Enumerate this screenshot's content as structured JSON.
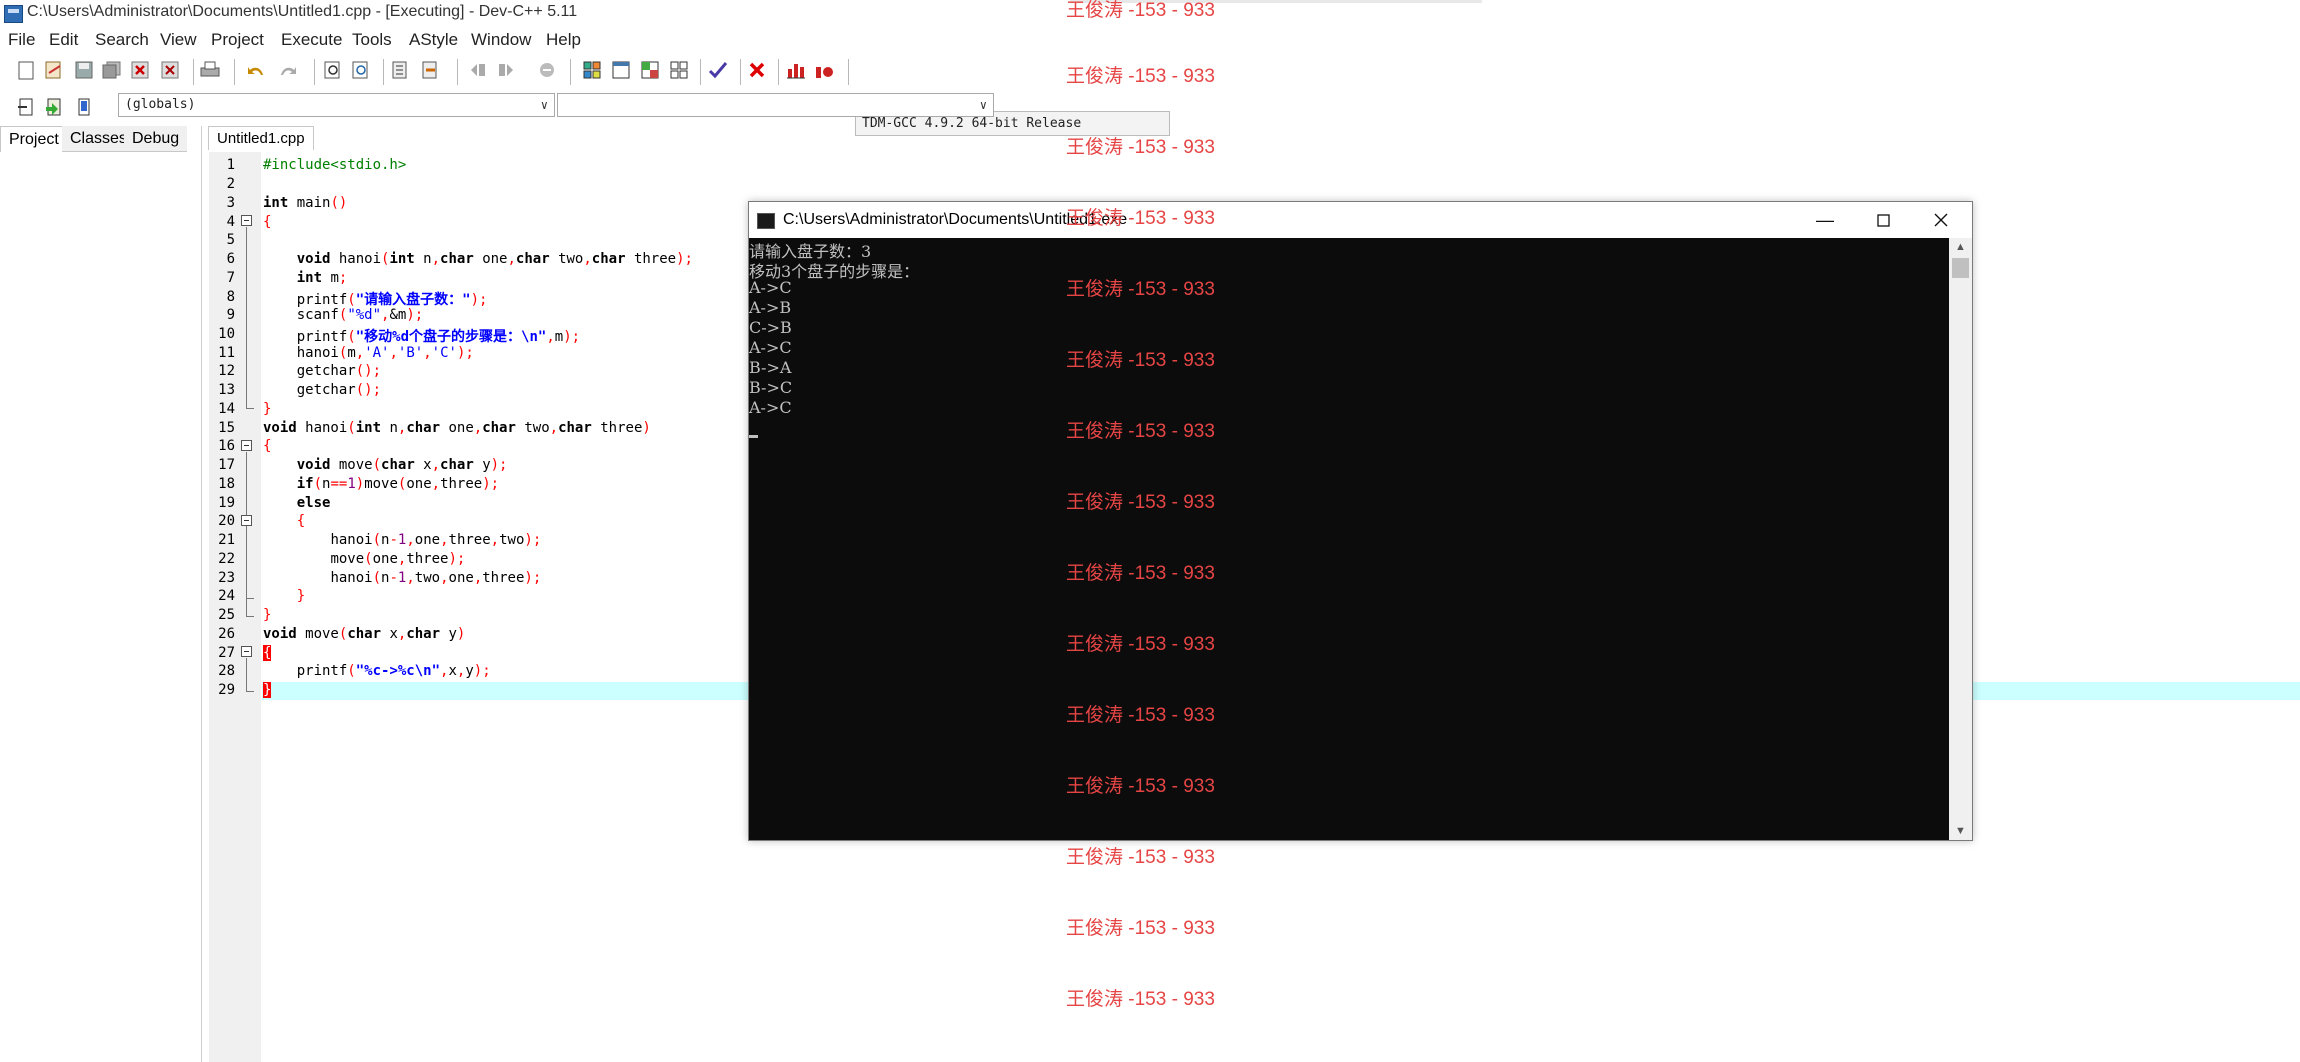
{
  "window": {
    "title": "C:\\Users\\Administrator\\Documents\\Untitled1.cpp - [Executing] - Dev-C++ 5.11"
  },
  "menu": [
    "File",
    "Edit",
    "Search",
    "View",
    "Project",
    "Execute",
    "Tools",
    "AStyle",
    "Window",
    "Help"
  ],
  "toolbar": {
    "compiler": "TDM-GCC 4.9.2 64-bit Release",
    "globals_combo": "(globals)",
    "functions_combo": ""
  },
  "leftpanel": {
    "tabs": [
      "Project",
      "Classes",
      "Debug"
    ],
    "active": "Project"
  },
  "editor": {
    "tab": "Untitled1.cpp",
    "line_numbers": [
      "1",
      "2",
      "3",
      "4",
      "5",
      "6",
      "7",
      "8",
      "9",
      "10",
      "11",
      "12",
      "13",
      "14",
      "15",
      "16",
      "17",
      "18",
      "19",
      "20",
      "21",
      "22",
      "23",
      "24",
      "25",
      "26",
      "27",
      "28",
      "29"
    ],
    "code": {
      "l1": "#include<stdio.h>",
      "l3a": "int",
      "l3b": " main",
      "l4": "{",
      "l6a": "void",
      "l6b": " hanoi",
      "l6c": "int",
      "l6d": " n",
      "l6e": "char",
      "l6f": " one",
      "l6g": "char",
      "l6h": " two",
      "l6i": "char",
      "l6j": " three",
      "l7a": "int",
      "l7b": " m",
      "l8a": "printf",
      "l8b": "\"请输入盘子数：\"",
      "l9a": "scanf",
      "l9b": "\"%d\"",
      "l9c": "&m",
      "l10a": "printf",
      "l10b": "\"移动%d个盘子的步骤是：\\n\"",
      "l10c": "m",
      "l11a": "hanoi",
      "l11b": "m",
      "l11c": "'A'",
      "l11d": "'B'",
      "l11e": "'C'",
      "l12": "getchar",
      "l13": "getchar",
      "l14": "}",
      "l15a": "void",
      "l15b": " hanoi",
      "l15c": "int",
      "l15d": " n",
      "l15e": "char",
      "l15f": " one",
      "l15g": "char",
      "l15h": " two",
      "l15i": "char",
      "l15j": " three",
      "l16": "{",
      "l17a": "void",
      "l17b": " move",
      "l17c": "char",
      "l17d": " x",
      "l17e": "char",
      "l17f": " y",
      "l18a": "if",
      "l18b": "n",
      "l18c": "1",
      "l18d": "move",
      "l18e": "one",
      "l18f": "three",
      "l19": "else",
      "l20": "{",
      "l21a": "hanoi",
      "l21b": "n",
      "l21c": "1",
      "l21d": "one",
      "l21e": "three",
      "l21f": "two",
      "l22a": "move",
      "l22b": "one",
      "l22c": "three",
      "l23a": "hanoi",
      "l23b": "n",
      "l23c": "1",
      "l23d": "two",
      "l23e": "one",
      "l23f": "three",
      "l24": "}",
      "l25": "}",
      "l26a": "void",
      "l26b": " move",
      "l26c": "char",
      "l26d": " x",
      "l26e": "char",
      "l26f": " y",
      "l27": "{",
      "l28a": "printf",
      "l28b": "\"%c->%c\\n\"",
      "l28c": "x",
      "l28d": "y",
      "l29": "}"
    }
  },
  "console": {
    "title": "C:\\Users\\Administrator\\Documents\\Untitled1.exe",
    "lines": [
      "请输入盘子数：3",
      "移动3个盘子的步骤是：",
      "A->C",
      "A->B",
      "C->B",
      "A->C",
      "B->A",
      "B->C",
      "A->C"
    ]
  },
  "watermark": "王俊涛 -153 - 933"
}
